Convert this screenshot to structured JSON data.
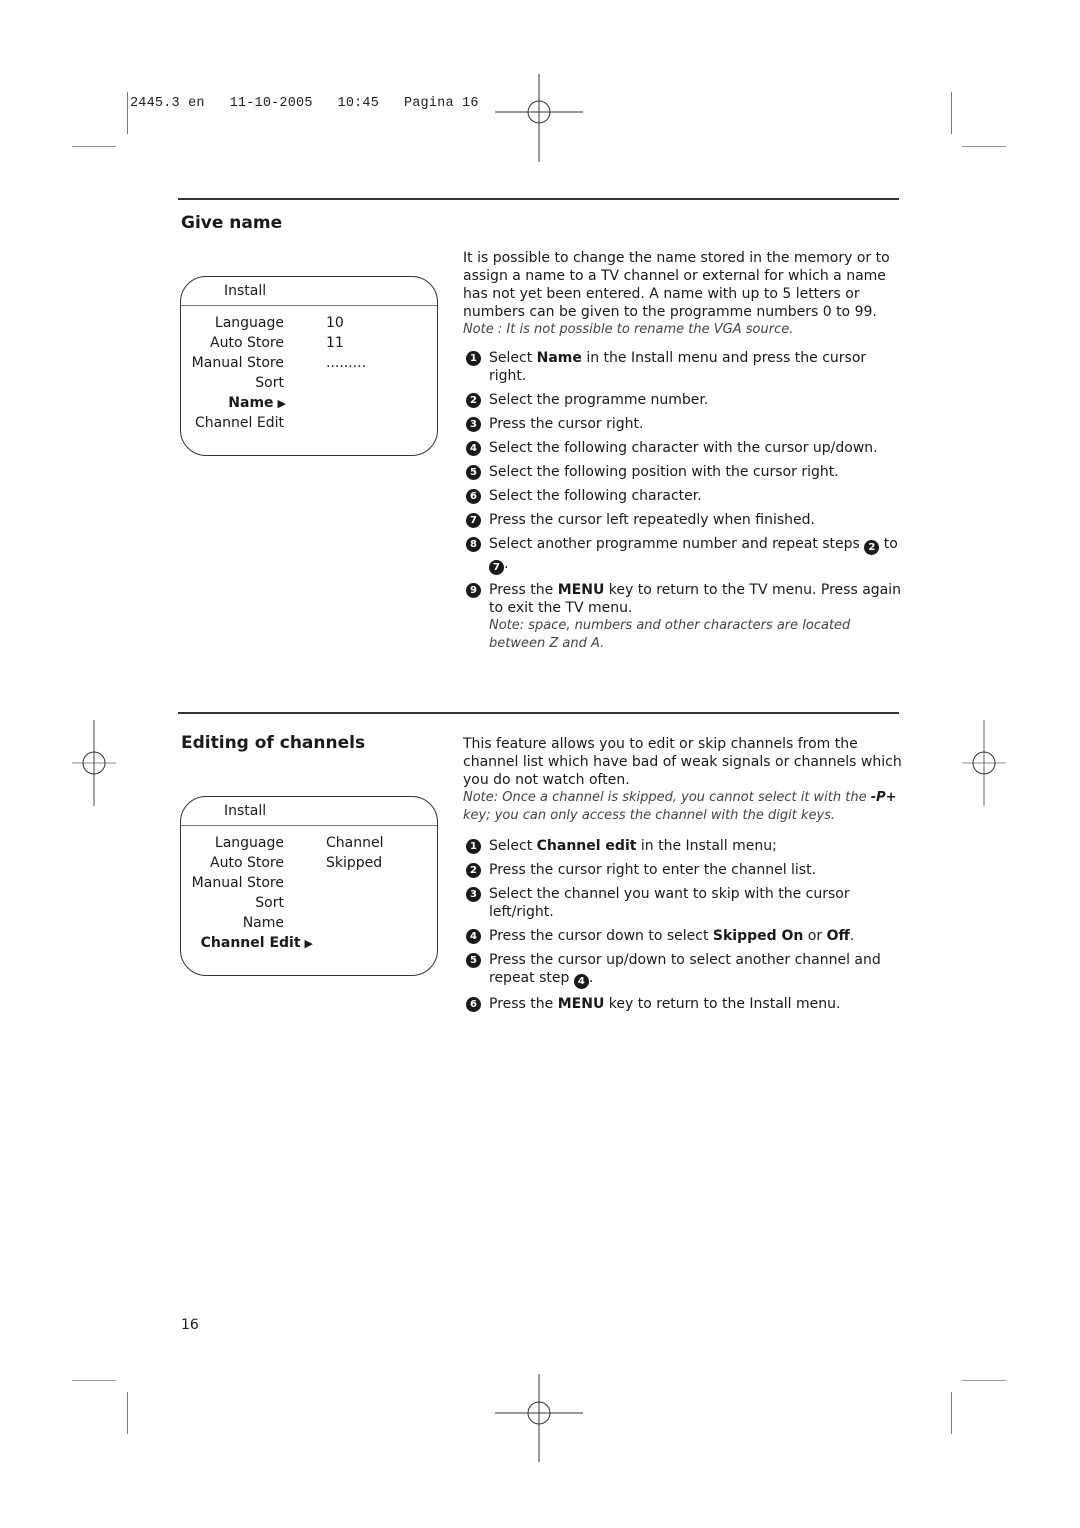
{
  "slug": "2445.3 en   11-10-2005   10:45   Pagina 16",
  "page_number": "16",
  "give_name": {
    "title": "Give name",
    "menu": {
      "title": "Install",
      "rows": [
        {
          "label": "Language",
          "value": "10"
        },
        {
          "label": "Auto Store",
          "value": "11"
        },
        {
          "label": "Manual Store",
          "value": "........."
        },
        {
          "label": "Sort",
          "value": ""
        },
        {
          "label": "Name",
          "value": "",
          "active": true
        },
        {
          "label": "Channel Edit",
          "value": ""
        }
      ],
      "arrow": "▶"
    },
    "intro": "It is possible to change the name stored in the memory or to assign a name to a TV channel or external for which a name has not yet been entered. A name with up to 5 letters or numbers can be given to the programme numbers 0 to 99.",
    "note": "Note : It is not possible to rename the VGA  source.",
    "steps": [
      {
        "n": "1",
        "pre": "Select ",
        "bold": "Name",
        "post": " in the Install menu and press the cursor right."
      },
      {
        "n": "2",
        "pre": "Select the programme number.",
        "bold": "",
        "post": ""
      },
      {
        "n": "3",
        "pre": "Press the cursor right.",
        "bold": "",
        "post": ""
      },
      {
        "n": "4",
        "pre": "Select the following character with the cursor up/down.",
        "bold": "",
        "post": ""
      },
      {
        "n": "5",
        "pre": "Select the following position with the cursor right.",
        "bold": "",
        "post": ""
      },
      {
        "n": "6",
        "pre": "Select the following character.",
        "bold": "",
        "post": ""
      },
      {
        "n": "7",
        "pre": "Press the cursor left repeatedly when finished.",
        "bold": "",
        "post": ""
      }
    ],
    "step8": {
      "n": "8",
      "pre": "Select another programme number and repeat steps ",
      "ref1": "2",
      "mid": " to ",
      "ref2": "7",
      "post": "."
    },
    "step9": {
      "n": "9",
      "pre": "Press the ",
      "bold": "MENU",
      "post": " key to return to the TV menu. Press again to exit the TV menu.",
      "note": "Note: space, numbers and other characters are located between Z and A."
    }
  },
  "editing": {
    "title": "Editing of channels",
    "menu": {
      "title": "Install",
      "rows": [
        {
          "label": "Language",
          "value": "Channel"
        },
        {
          "label": "Auto Store",
          "value": "Skipped"
        },
        {
          "label": "Manual Store",
          "value": ""
        },
        {
          "label": "Sort",
          "value": ""
        },
        {
          "label": "Name",
          "value": ""
        },
        {
          "label": "Channel Edit",
          "value": "",
          "active": true
        }
      ],
      "arrow": "▶"
    },
    "intro": "This feature allows you to edit or skip channels from the channel list which have bad of weak signals or channels which you do not watch often.",
    "note_pre": "Note: Once a channel is skipped, you cannot select it with the ",
    "note_key": "-P+",
    "note_post": " key; you can only access the channel with the digit keys.",
    "steps": [
      {
        "n": "1",
        "pre": "Select ",
        "bold": "Channel edit",
        "post": " in the Install menu;"
      },
      {
        "n": "2",
        "pre": "Press the cursor right to enter the channel list.",
        "bold": "",
        "post": ""
      },
      {
        "n": "3",
        "pre": "Select the channel you want to skip with the cursor left/right.",
        "bold": "",
        "post": ""
      }
    ],
    "step4": {
      "n": "4",
      "pre": "Press the cursor down to select ",
      "bold1": "Skipped On",
      "mid": " or ",
      "bold2": "Off",
      "post": "."
    },
    "step5": {
      "n": "5",
      "pre": "Press the cursor up/down to select another channel and repeat step ",
      "ref": "4",
      "post": "."
    },
    "step6": {
      "n": "6",
      "pre": "Press the ",
      "bold": "MENU",
      "post": " key to return to the Install menu."
    }
  }
}
